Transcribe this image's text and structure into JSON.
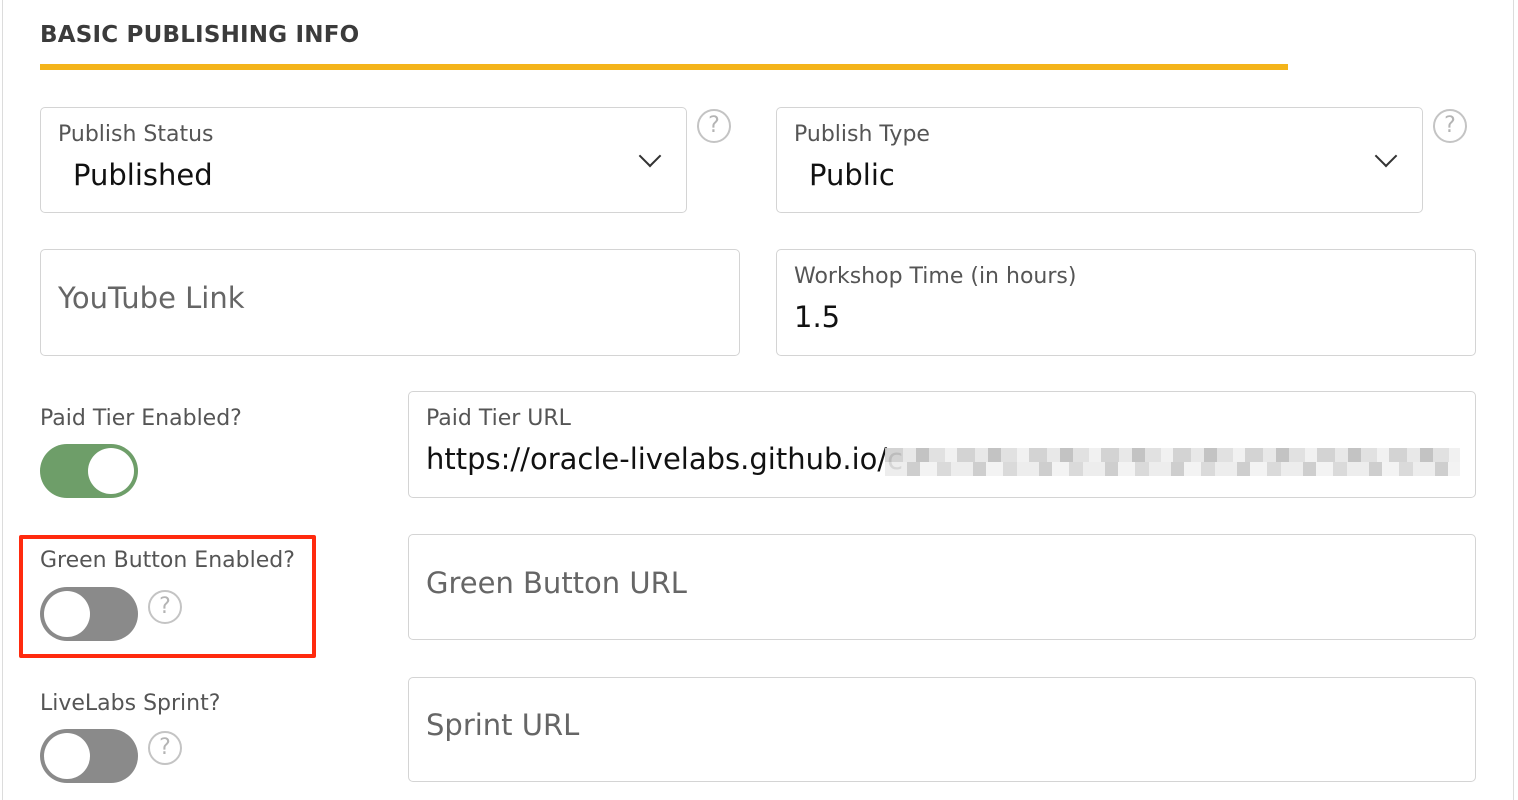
{
  "section": {
    "title": "BASIC PUBLISHING INFO"
  },
  "publish_status": {
    "label": "Publish Status",
    "value": "Published"
  },
  "publish_type": {
    "label": "Publish Type",
    "value": "Public"
  },
  "youtube_link": {
    "placeholder": "YouTube Link"
  },
  "workshop_time": {
    "label": "Workshop Time (in hours)",
    "value": "1.5"
  },
  "paid_tier": {
    "toggle_label": "Paid Tier Enabled?",
    "enabled": true,
    "url_label": "Paid Tier URL",
    "url_value": "https://oracle-livelabs.github.io/c"
  },
  "green_button": {
    "toggle_label": "Green Button Enabled?",
    "enabled": false,
    "url_placeholder": "Green Button URL"
  },
  "sprint": {
    "toggle_label": "LiveLabs Sprint?",
    "enabled": false,
    "url_placeholder": "Sprint URL"
  },
  "help_glyph": "?",
  "colors": {
    "accent": "#f4b41a",
    "toggle_on": "#6e9e69",
    "toggle_off": "#8a8a8a",
    "highlight": "#ff2a0e"
  }
}
